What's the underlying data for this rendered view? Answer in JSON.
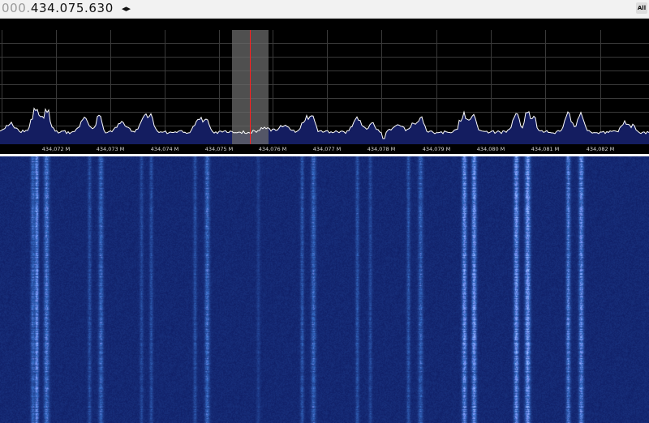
{
  "receiver": {
    "frequency_lead": "000.",
    "frequency_main": "434.075.630",
    "tune_arrows": "◂▸",
    "corner_button_label": "All"
  },
  "spectrum": {
    "tick_labels": [
      "434,072 M",
      "434,073 M",
      "434,074 M",
      "434,075 M",
      "434,076 M",
      "434,077 M",
      "434,078 M",
      "434,079 M",
      "434,080 M",
      "434,081 M",
      "434,082 M"
    ],
    "colors": {
      "background": "#000000",
      "grid": "#3a3a3a",
      "trace": "#ffffff",
      "fill": "#141d60",
      "tuner_highlight": "#6a6a6a",
      "tuner_line": "#ff2020"
    }
  },
  "waterfall": {
    "colors": {
      "background": "#0b1560",
      "signal": "#5fb0ff"
    }
  }
}
